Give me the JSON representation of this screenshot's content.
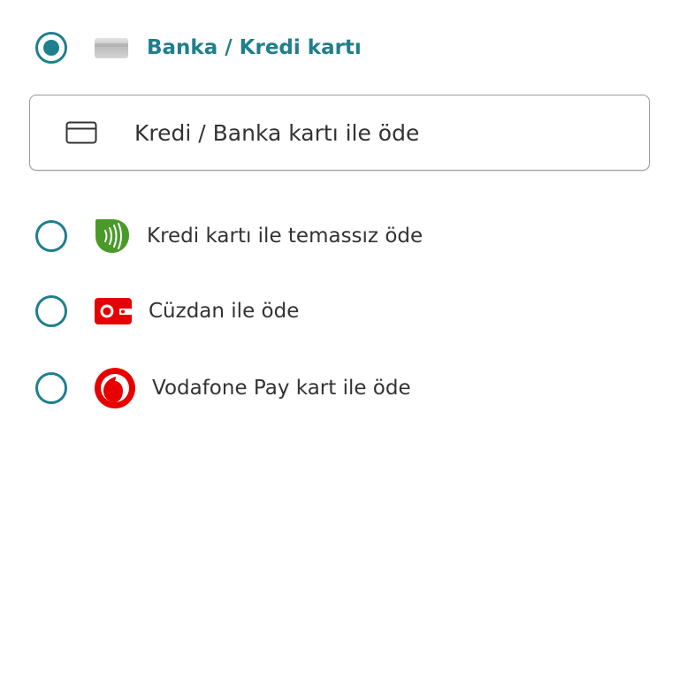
{
  "payment_methods": {
    "card": {
      "label": "Banka / Kredi kartı",
      "selected": true,
      "icon": "bank-card-icon",
      "button_label": "Kredi / Banka kartı ile öde",
      "button_icon": "credit-card-outline-icon"
    },
    "contactless": {
      "label": "Kredi kartı ile temassız öde",
      "selected": false,
      "icon": "contactless-icon"
    },
    "wallet": {
      "label": "Cüzdan ile öde",
      "selected": false,
      "icon": "wallet-icon"
    },
    "vodafone_pay": {
      "label": "Vodafone Pay kart ile öde",
      "selected": false,
      "icon": "vodafone-logo-icon"
    }
  },
  "colors": {
    "accent": "#1f7f8e",
    "contactless_green": "#4a9a2a",
    "vodafone_red": "#e60000",
    "text": "#333333",
    "border": "#9a9a9a"
  }
}
